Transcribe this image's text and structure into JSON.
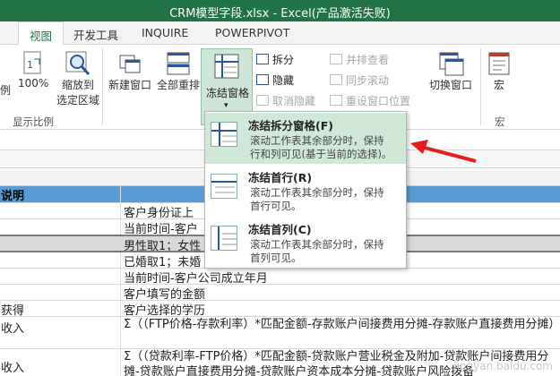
{
  "window": {
    "title": "CRM模型字段.xlsx -  Excel(产品激活失败)"
  },
  "tabs": [
    "视图",
    "开发工具",
    "INQUIRE",
    "POWERPIVOT"
  ],
  "ribbon": {
    "left_partial": "例",
    "zoom100": "100%",
    "zoom_selection": [
      "缩放到",
      "选定区域"
    ],
    "group_zoom": "显示比例",
    "new_window": "新建窗口",
    "arrange_all": "全部重排",
    "freeze_panes": "冻结窗格",
    "split": "拆分",
    "hide": "隐藏",
    "unhide": "取消隐藏",
    "view_side_by_side": "并排查看",
    "sync_scroll": "同步滚动",
    "reset_position": "重设窗口位置",
    "switch_windows": "切换窗口",
    "macros": "宏",
    "group_macros": "宏"
  },
  "freeze_menu": {
    "items": [
      {
        "title": "冻结拆分窗格(F)",
        "desc": [
          "滚动工作表其余部分时，保持",
          "行和列可见(基于当前的选择)。"
        ]
      },
      {
        "title": "冻结首行(R)",
        "desc": [
          "滚动工作表其余部分时，保持",
          "首行可见。"
        ]
      },
      {
        "title": "冻结首列(C)",
        "desc": [
          "滚动工作表其余部分时，保持",
          "首列可见。"
        ]
      }
    ]
  },
  "sheet": {
    "header_a": "说明",
    "rows": [
      {
        "a": "",
        "b": "客户身份证上"
      },
      {
        "a": "",
        "b": "当前时间-客户"
      },
      {
        "a": "",
        "b": "男性取1；女性"
      },
      {
        "a": "",
        "b": "已婚取1；未婚"
      },
      {
        "a": "",
        "b": "当前时间-客户公司成立年月"
      },
      {
        "a": "",
        "b": "客户填写的金额"
      },
      {
        "a": "获得",
        "b": "客户选择的学历"
      },
      {
        "a": "收入",
        "b": "Σ（（FTP价格-存款利率）*匹配金额-存款账户间接费用分摊-存款账户直接费用分摊）"
      },
      {
        "a": "收入",
        "b": "Σ（（贷款利率-FTP价格）*匹配金额-贷款账户营业税金及附加-贷款账户间接费用分摊-贷款账户直接费用分摊-贷款账户资本成本分摊-贷款账户风险拨备"
      }
    ]
  },
  "colors": {
    "excel_green": "#217346",
    "header_blue": "#5b9bd5",
    "arrow_red": "#e31c1c"
  },
  "watermark": "jingyan.baidu.com"
}
